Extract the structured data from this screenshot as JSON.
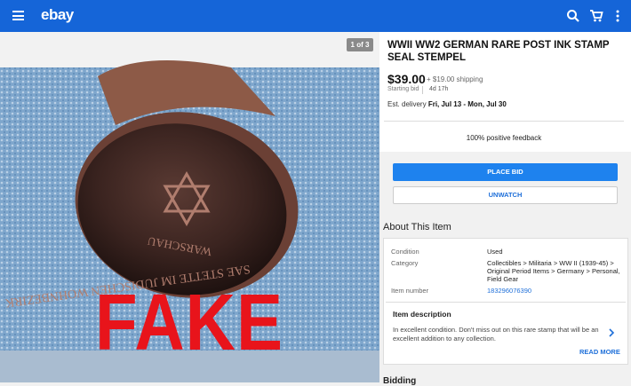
{
  "appbar": {
    "logo": "ebay",
    "icons": [
      "menu-icon",
      "search-icon",
      "cart-icon",
      "more-vertical-icon"
    ],
    "color": "#1565d8"
  },
  "gallery": {
    "counter": "1 of 3",
    "overlay_text": "FAKE",
    "overlay_color": "#e8141b",
    "stamp_text_outer": "SAE STETTE IM JUDISCHEN WOHNBEZIRK",
    "stamp_text_inner": "WARSCHAU"
  },
  "listing": {
    "title": "WWII WW2 GERMAN RARE POST INK STAMP SEAL STEMPEL",
    "price": "$39.00",
    "shipping": "+ $19.00 shipping",
    "starting_bid_label": "Starting bid",
    "time_left": "4d 17h",
    "delivery_label": "Est. delivery",
    "delivery_dates": "Fri, Jul 13 - Mon, Jul 30",
    "feedback": "100% positive feedback"
  },
  "actions": {
    "place_bid": "PLACE BID",
    "unwatch": "UNWATCH",
    "accent": "#1e82ee"
  },
  "about": {
    "heading": "About This Item",
    "condition_label": "Condition",
    "condition_value": "Used",
    "category_label": "Category",
    "category_value": "Collectibles > Militaria > WW II (1939-45) > Original Period Items > Germany > Personal, Field Gear",
    "item_number_label": "Item number",
    "item_number_value": "183296076390",
    "description_heading": "Item description",
    "description_text": "In excellent condition. Don't miss out on this rare stamp that will be an excellent addition to any collection.",
    "read_more": "READ MORE"
  },
  "next_section": {
    "heading": "Bidding"
  }
}
